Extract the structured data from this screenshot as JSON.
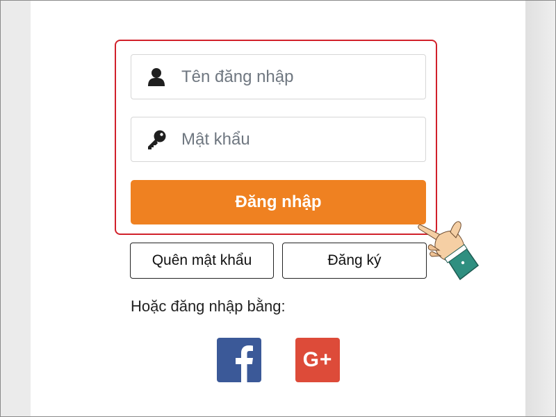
{
  "form": {
    "username_placeholder": "Tên đăng nhập",
    "username_value": "",
    "password_placeholder": "Mật khẩu",
    "password_value": "",
    "login_label": "Đăng nhập"
  },
  "links": {
    "forgot_password_label": "Quên mật khẩu",
    "register_label": "Đăng ký"
  },
  "social": {
    "prompt": "Hoặc đăng nhập bằng:",
    "facebook_icon": "facebook-icon",
    "google_plus_icon": "google-plus-icon",
    "google_plus_text": "G+"
  },
  "colors": {
    "accent_orange": "#ef8121",
    "highlight_red": "#d1202a",
    "facebook_blue": "#3b5998",
    "google_red": "#dd4b39"
  },
  "icons": {
    "username": "user-icon",
    "password": "key-icon",
    "pointer": "pointing-hand-icon"
  }
}
